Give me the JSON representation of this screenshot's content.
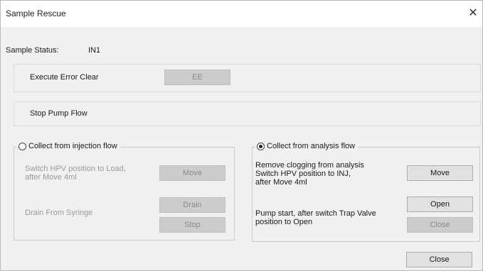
{
  "window": {
    "title": "Sample Rescue",
    "close_glyph": "✕"
  },
  "sample_status": {
    "label": "Sample Status:",
    "value": "IN1"
  },
  "execute_error_clear": {
    "label": "Execute Error Clear",
    "button": "EE"
  },
  "stop_pump_flow": {
    "label": "Stop Pump Flow"
  },
  "collect_injection": {
    "legend": "Collect from injection flow",
    "selected": false,
    "switch_text_line1": "Switch HPV position to Load,",
    "switch_text_line2": "after Move 4ml",
    "move_button": "Move",
    "drain_syringe_label": "Drain From Syringe",
    "drain_button": "Drain",
    "stop_button": "Stop"
  },
  "collect_analysis": {
    "legend": "Collect from analysis flow",
    "selected": true,
    "remove_text_line1": "Remove clogging from analysis",
    "remove_text_line2": "Switch HPV position to INJ,",
    "remove_text_line3": "after Move 4ml",
    "move_button": "Move",
    "pump_text_line1": "Pump start, after switch Trap Valve",
    "pump_text_line2": "position to Open",
    "open_button": "Open",
    "close_button": "Close"
  },
  "footer": {
    "close_button": "Close"
  }
}
